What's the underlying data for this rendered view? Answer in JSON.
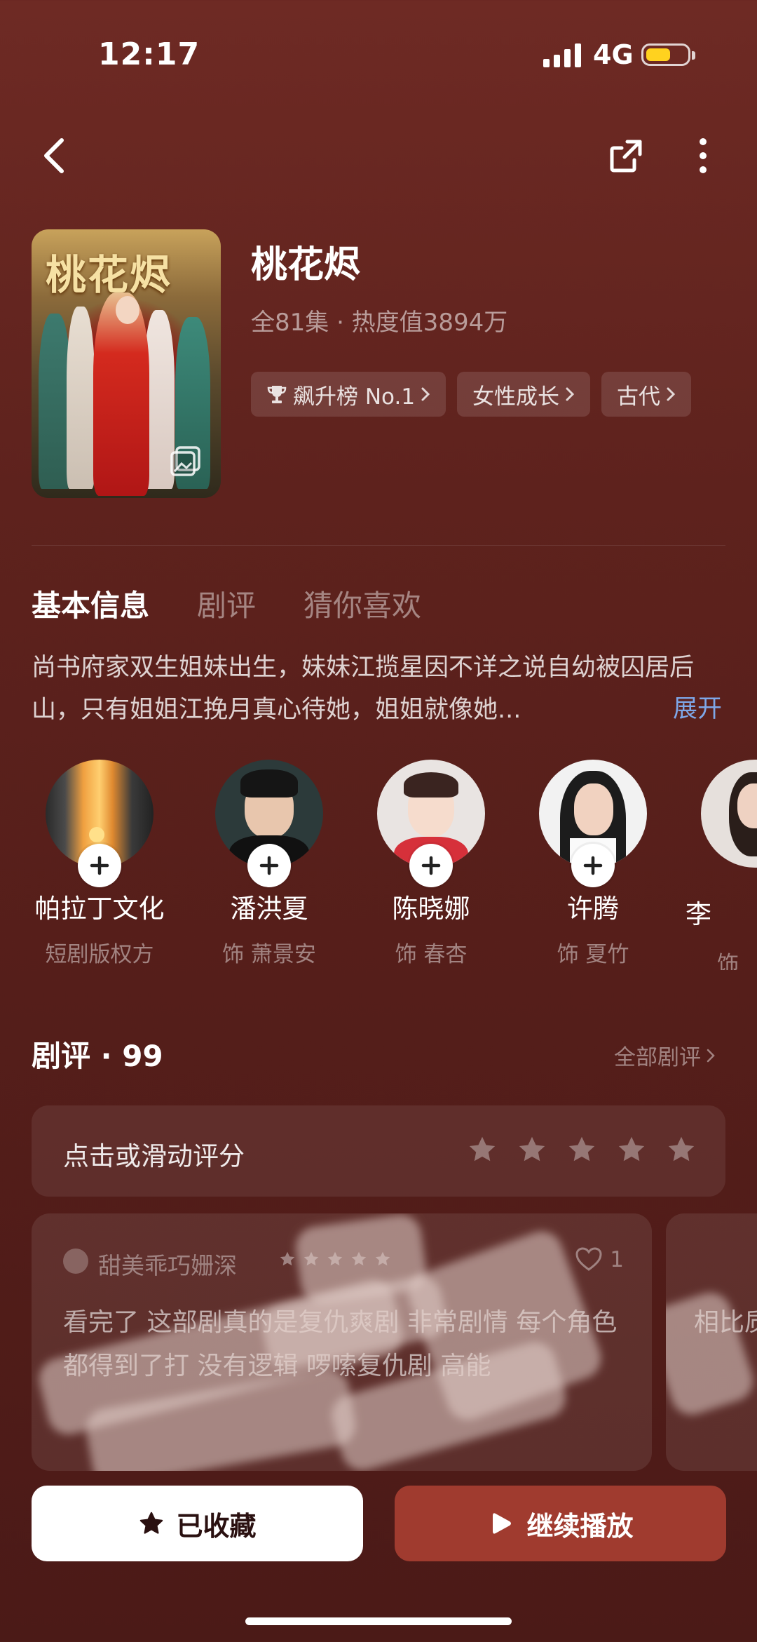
{
  "status_bar": {
    "time": "12:17",
    "network": "4G"
  },
  "drama": {
    "poster_title": "桃花烬",
    "title": "桃花烬",
    "subtitle": "全81集 · 热度值3894万",
    "tags": [
      {
        "label": "飙升榜 No.1",
        "icon": "trophy-icon"
      },
      {
        "label": "女性成长"
      },
      {
        "label": "古代"
      }
    ]
  },
  "tabs": [
    "基本信息",
    "剧评",
    "猜你喜欢"
  ],
  "synopsis": {
    "text": "尚书府家双生姐妹出生，妹妹江揽星因不详之说自幼被囚居后山，只有姐姐江挽月真心待她，姐姐就像她...",
    "expand_label": "展开"
  },
  "cast": [
    {
      "name": "帕拉丁文化",
      "role": "短剧版权方"
    },
    {
      "name": "潘洪夏",
      "role": "饰 萧景安"
    },
    {
      "name": "陈晓娜",
      "role": "饰 春杏"
    },
    {
      "name": "许腾",
      "role": "饰 夏竹"
    },
    {
      "name": "李",
      "role": "饰"
    }
  ],
  "reviews": {
    "title": "剧评 · 99",
    "all_label": "全部剧评",
    "rate_prompt": "点击或滑动评分",
    "card": {
      "user": "甜美乖巧姗深",
      "likes": "1",
      "text": "看完了 这部剧真的是复仇爽剧 非常剧情 每个角色都得到了打 没有逻辑 啰嗦复仇剧 高能"
    },
    "card2": {
      "text": "相比质量总让"
    }
  },
  "buttons": {
    "favorite": "已收藏",
    "play": "继续播放"
  },
  "colors": {
    "background": "#5e221d",
    "play_button": "#a03b2f",
    "expand_link": "#7ea7e8",
    "battery": "#ffd21f"
  }
}
